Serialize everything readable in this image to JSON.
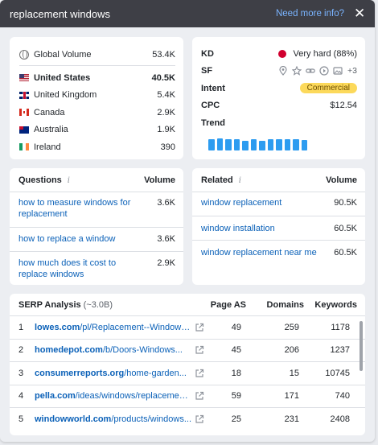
{
  "header": {
    "title": "replacement windows",
    "more_info": "Need more info?",
    "close_icon": "close-icon"
  },
  "volume": {
    "global": {
      "label": "Global Volume",
      "value": "53.4K",
      "icon": "globe-icon"
    },
    "countries": [
      {
        "name": "United States",
        "value": "40.5K",
        "flag": "us-flag-icon",
        "bold": true
      },
      {
        "name": "United Kingdom",
        "value": "5.4K",
        "flag": "uk-flag-icon"
      },
      {
        "name": "Canada",
        "value": "2.9K",
        "flag": "ca-flag-icon"
      },
      {
        "name": "Australia",
        "value": "1.9K",
        "flag": "au-flag-icon"
      },
      {
        "name": "Ireland",
        "value": "390",
        "flag": "ie-flag-icon"
      }
    ]
  },
  "metrics": {
    "kd_label": "KD",
    "kd_value": "Very hard (88%)",
    "kd_color": "#d1002f",
    "sf_label": "SF",
    "sf_icons": [
      "location-pin-icon",
      "star-icon",
      "link-icon",
      "video-play-icon",
      "image-icon"
    ],
    "sf_more": "+3",
    "intent_label": "Intent",
    "intent_value": "Commercial",
    "cpc_label": "CPC",
    "cpc_value": "$12.54",
    "trend_label": "Trend",
    "trend_values": [
      0.95,
      1.0,
      0.95,
      0.95,
      0.8,
      0.95,
      0.8,
      0.95,
      0.95,
      0.95,
      0.95,
      0.9
    ]
  },
  "questions": {
    "header": "Questions",
    "volume_header": "Volume",
    "rows": [
      {
        "text": "how to measure windows for replacement",
        "volume": "3.6K"
      },
      {
        "text": "how to replace a window",
        "volume": "3.6K"
      },
      {
        "text": "how much does it cost to replace windows",
        "volume": "2.9K"
      }
    ]
  },
  "related": {
    "header": "Related",
    "volume_header": "Volume",
    "rows": [
      {
        "text": "window replacement",
        "volume": "90.5K"
      },
      {
        "text": "window installation",
        "volume": "60.5K"
      },
      {
        "text": "window replacement near me",
        "volume": "60.5K"
      }
    ]
  },
  "serp": {
    "title": "SERP Analysis",
    "results_count": "(~3.0B)",
    "col_page_as": "Page AS",
    "col_domains": "Domains",
    "col_keywords": "Keywords",
    "rows": [
      {
        "rank": "1",
        "domain": "lowes.com",
        "path": "/pl/Replacement--Windows...",
        "page_as": "49",
        "domains": "259",
        "keywords": "1178"
      },
      {
        "rank": "2",
        "domain": "homedepot.com",
        "path": "/b/Doors-Windows...",
        "page_as": "45",
        "domains": "206",
        "keywords": "1237"
      },
      {
        "rank": "3",
        "domain": "consumerreports.org",
        "path": "/home-garden...",
        "page_as": "18",
        "domains": "15",
        "keywords": "10745"
      },
      {
        "rank": "4",
        "domain": "pella.com",
        "path": "/ideas/windows/replacement...",
        "page_as": "59",
        "domains": "171",
        "keywords": "740"
      },
      {
        "rank": "5",
        "domain": "windowworld.com",
        "path": "/products/windows...",
        "page_as": "25",
        "domains": "231",
        "keywords": "2408"
      }
    ]
  }
}
